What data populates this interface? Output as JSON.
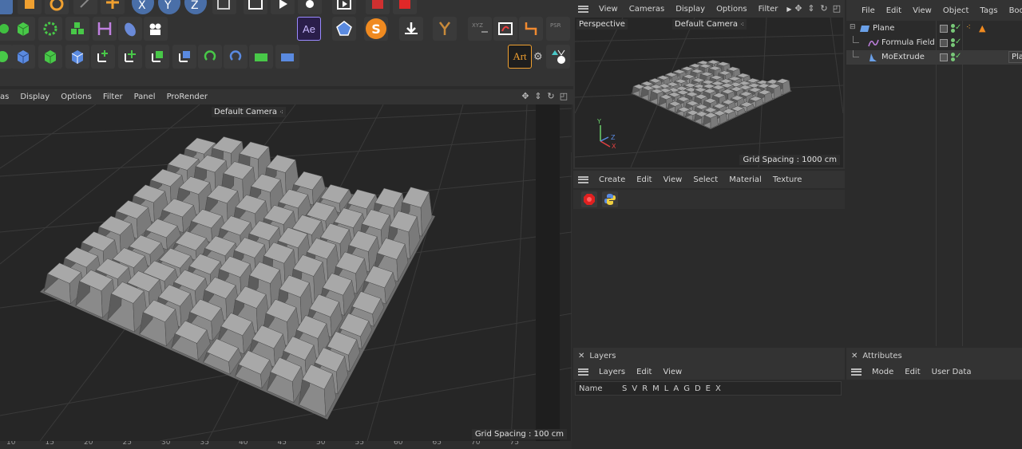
{
  "toolbar": {
    "art_label": "Art",
    "ae_label": "Ae",
    "s_label": "S"
  },
  "left_viewport": {
    "menu": [
      "as",
      "Display",
      "Options",
      "Filter",
      "Panel",
      "ProRender"
    ],
    "camera_label": "Default Camera",
    "grid_spacing": "Grid Spacing : 100 cm",
    "ruler_ticks": [
      "10",
      "15",
      "20",
      "25",
      "30",
      "35",
      "40",
      "45",
      "50",
      "55",
      "60",
      "65",
      "70",
      "75"
    ]
  },
  "right_viewport": {
    "menu": [
      "View",
      "Cameras",
      "Display",
      "Options",
      "Filter"
    ],
    "view_name": "Perspective",
    "camera_label": "Default Camera",
    "grid_spacing": "Grid Spacing : 1000 cm",
    "axis": {
      "y": "Y",
      "z": "Z",
      "x": "X"
    }
  },
  "material_manager": {
    "menu": [
      "Create",
      "Edit",
      "View",
      "Select",
      "Material",
      "Texture"
    ]
  },
  "layers": {
    "title": "Layers",
    "menu": [
      "Layers",
      "Edit",
      "View"
    ],
    "col_name": "Name",
    "col_flags": [
      "S",
      "V",
      "R",
      "M",
      "L",
      "A",
      "G",
      "D",
      "E",
      "X"
    ]
  },
  "object_manager": {
    "menu": [
      "File",
      "Edit",
      "View",
      "Object",
      "Tags",
      "Book"
    ],
    "objects": [
      {
        "name": "Plane"
      },
      {
        "name": "Formula Field"
      },
      {
        "name": "MoExtrude"
      }
    ],
    "tooltip": "Pla"
  },
  "attributes": {
    "title": "Attributes",
    "menu": [
      "Mode",
      "Edit",
      "User Data"
    ]
  }
}
